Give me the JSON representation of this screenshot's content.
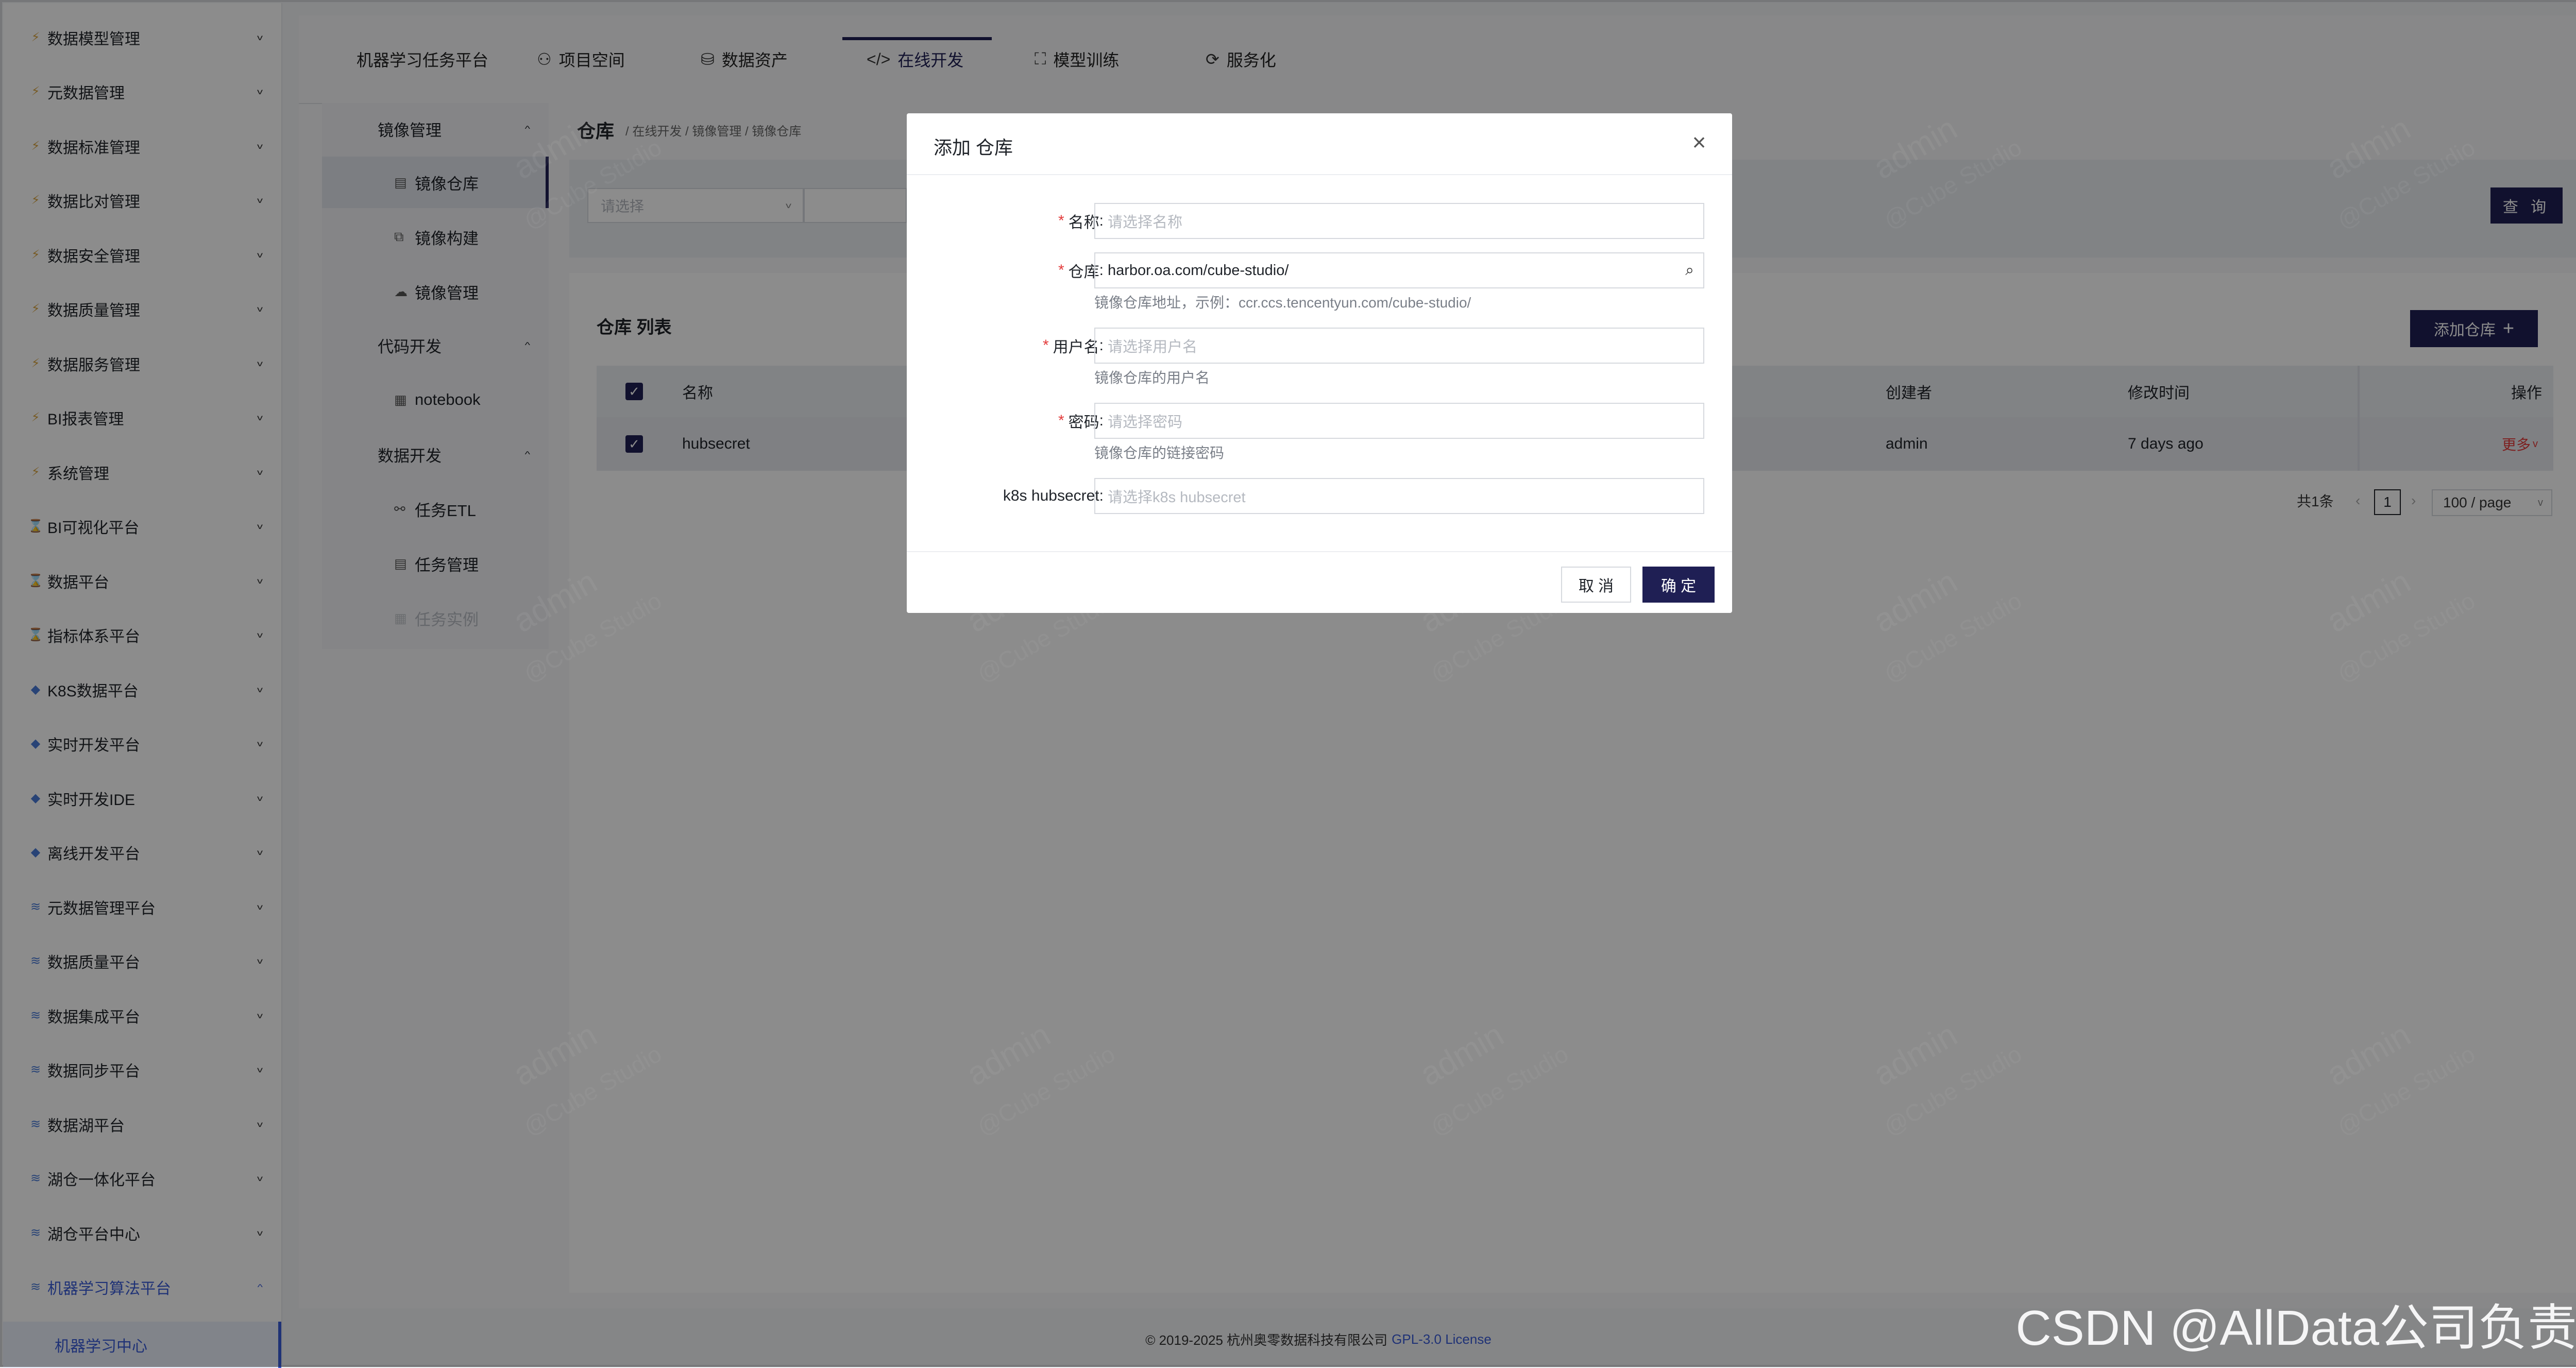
{
  "sidebar": {
    "items": [
      {
        "label": "数据模型管理",
        "icon": "lightning-icon"
      },
      {
        "label": "元数据管理",
        "icon": "lightning-icon"
      },
      {
        "label": "数据标准管理",
        "icon": "lightning-icon"
      },
      {
        "label": "数据比对管理",
        "icon": "lightning-icon"
      },
      {
        "label": "数据安全管理",
        "icon": "lightning-icon"
      },
      {
        "label": "数据质量管理",
        "icon": "lightning-icon"
      },
      {
        "label": "数据服务管理",
        "icon": "lightning-icon"
      },
      {
        "label": "BI报表管理",
        "icon": "lightning-icon"
      },
      {
        "label": "系统管理",
        "icon": "lightning-icon"
      },
      {
        "label": "BI可视化平台",
        "icon": "hourglass-icon"
      },
      {
        "label": "数据平台",
        "icon": "hourglass-icon"
      },
      {
        "label": "指标体系平台",
        "icon": "hourglass-icon"
      },
      {
        "label": "K8S数据平台",
        "icon": "diamond-icon"
      },
      {
        "label": "实时开发平台",
        "icon": "diamond-icon"
      },
      {
        "label": "实时开发IDE",
        "icon": "diamond-icon"
      },
      {
        "label": "离线开发平台",
        "icon": "diamond-icon"
      },
      {
        "label": "元数据管理平台",
        "icon": "stack-icon"
      },
      {
        "label": "数据质量平台",
        "icon": "stack-icon"
      },
      {
        "label": "数据集成平台",
        "icon": "stack-icon"
      },
      {
        "label": "数据同步平台",
        "icon": "stack-icon"
      },
      {
        "label": "数据湖平台",
        "icon": "stack-icon"
      },
      {
        "label": "湖仓一体化平台",
        "icon": "stack-icon"
      },
      {
        "label": "湖仓平台中心",
        "icon": "stack-icon"
      },
      {
        "label": "机器学习算法平台",
        "icon": "stack-icon"
      }
    ],
    "sub_item": "机器学习中心"
  },
  "topnav": {
    "brand": "机器学习任务平台",
    "tabs": [
      {
        "label": "项目空间",
        "icon": "group-icon"
      },
      {
        "label": "数据资产",
        "icon": "database-icon"
      },
      {
        "label": "在线开发",
        "icon": "code-icon"
      },
      {
        "label": "模型训练",
        "icon": "training-icon"
      },
      {
        "label": "服务化",
        "icon": "service-icon"
      }
    ],
    "active_tab": "在线开发"
  },
  "subnav": {
    "groups": [
      {
        "label": "镜像管理",
        "items": [
          "镜像仓库",
          "镜像构建",
          "镜像管理"
        ]
      },
      {
        "label": "代码开发",
        "items": [
          "notebook"
        ]
      },
      {
        "label": "数据开发",
        "items": [
          "任务ETL",
          "任务管理",
          "任务实例"
        ]
      }
    ],
    "active_item": "镜像仓库"
  },
  "page": {
    "title": "仓库",
    "breadcrumb": "/ 在线开发 / 镜像管理 / 镜像仓库",
    "filter_placeholder": "请选择",
    "query_button": "查 询",
    "list_title": "仓库 列表",
    "add_button": "添加仓库",
    "table": {
      "columns": {
        "name": "名称",
        "creator": "创建者",
        "modified": "修改时间",
        "ops": "操作"
      },
      "rows": [
        {
          "name": "hubsecret",
          "creator": "admin",
          "modified": "7 days ago",
          "ops": "更多"
        }
      ]
    },
    "pager": {
      "total": "共1条",
      "page": "1",
      "page_size": "100 / page"
    }
  },
  "modal": {
    "title": "添加 仓库",
    "fields": [
      {
        "label": "名称",
        "required": true,
        "value": "",
        "placeholder": "请选择名称",
        "help": ""
      },
      {
        "label": "仓库",
        "required": true,
        "value": "harbor.oa.com/cube-studio/",
        "placeholder": "",
        "help": "镜像仓库地址，示例：ccr.ccs.tencentyun.com/cube-studio/"
      },
      {
        "label": "用户名",
        "required": true,
        "value": "",
        "placeholder": "请选择用户名",
        "help": "镜像仓库的用户名"
      },
      {
        "label": "密码",
        "required": true,
        "value": "",
        "placeholder": "请选择密码",
        "help": "镜像仓库的链接密码"
      },
      {
        "label": "k8s hubsecret",
        "required": false,
        "value": "",
        "placeholder": "请选择k8s hubsecret",
        "help": ""
      }
    ],
    "cancel": "取 消",
    "ok": "确 定"
  },
  "footer": {
    "copyright": "© 2019-2025 杭州奥零数据科技有限公司",
    "license": "GPL-3.0 License"
  },
  "watermark": {
    "user": "admin",
    "org": "@Cube Studio"
  },
  "overlay_text": "CSDN @AllData公司负责人",
  "colors": {
    "primary": "#1f1f54",
    "link": "#3a5bd8",
    "required": "#e33b3b"
  }
}
